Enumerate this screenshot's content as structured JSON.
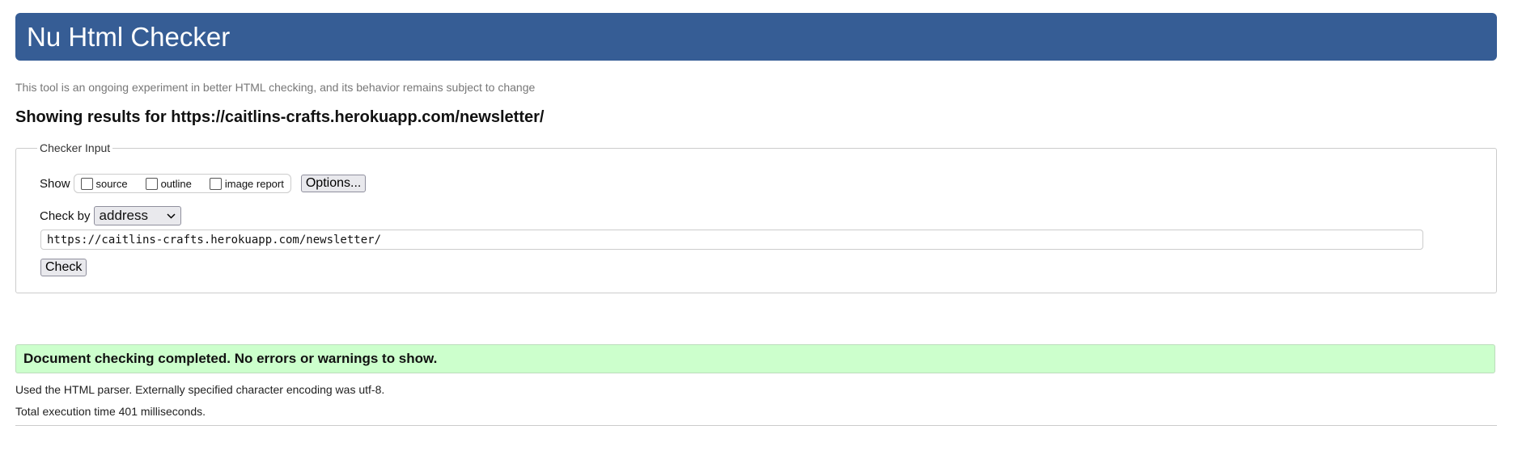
{
  "header": {
    "title": "Nu Html Checker"
  },
  "subtitle": "This tool is an ongoing experiment in better HTML checking, and its behavior remains subject to change",
  "results_heading": "Showing results for https://caitlins-crafts.herokuapp.com/newsletter/",
  "checker_input": {
    "legend": "Checker Input",
    "show_label": "Show",
    "show_options": [
      {
        "label": "source",
        "checked": false
      },
      {
        "label": "outline",
        "checked": false
      },
      {
        "label": "image report",
        "checked": false
      }
    ],
    "options_button": "Options...",
    "check_by_label": "Check by",
    "check_by_value": "address",
    "url_value": "https://caitlins-crafts.herokuapp.com/newsletter/",
    "check_button": "Check"
  },
  "status": {
    "message": "Document checking completed. No errors or warnings to show.",
    "color": "#ccffcc"
  },
  "details": [
    "Used the HTML parser. Externally specified character encoding was utf-8.",
    "Total execution time 401 milliseconds."
  ],
  "colors": {
    "header": "#365d95"
  }
}
